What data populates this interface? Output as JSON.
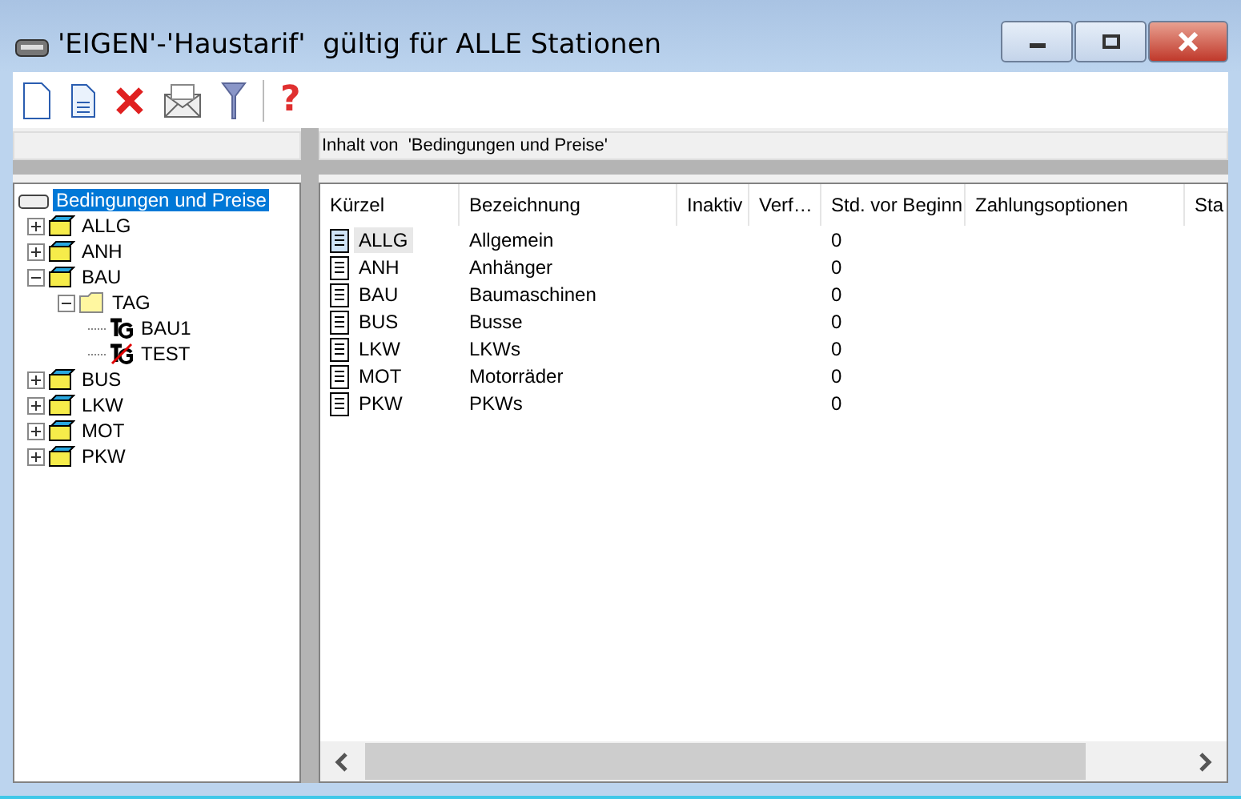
{
  "window": {
    "title": "'EIGEN'-'Haustarif'  gültig für ALLE Stationen"
  },
  "toolbar": {
    "help": "?"
  },
  "content_header": "Inhalt von  'Bedingungen und Preise'",
  "tree": {
    "label": "Bedingungen und Preise",
    "selected": true,
    "children": [
      {
        "label": "ALLG",
        "kind": "group",
        "expanded": false,
        "selected": false
      },
      {
        "label": "ANH",
        "kind": "group",
        "expanded": false,
        "selected": false
      },
      {
        "label": "BAU",
        "kind": "group",
        "expanded": true,
        "selected": false,
        "children": [
          {
            "label": "TAG",
            "kind": "folder",
            "expanded": true,
            "selected": false,
            "children": [
              {
                "label": "BAU1",
                "kind": "tariff",
                "inactive": false,
                "selected": false
              },
              {
                "label": "TEST",
                "kind": "tariff",
                "inactive": true,
                "selected": false
              }
            ]
          }
        ]
      },
      {
        "label": "BUS",
        "kind": "group",
        "expanded": false,
        "selected": false
      },
      {
        "label": "LKW",
        "kind": "group",
        "expanded": false,
        "selected": false
      },
      {
        "label": "MOT",
        "kind": "group",
        "expanded": false,
        "selected": false
      },
      {
        "label": "PKW",
        "kind": "group",
        "expanded": false,
        "selected": false
      }
    ]
  },
  "table": {
    "columns": [
      "Kürzel",
      "Bezeichnung",
      "Inaktiv",
      "Verf…",
      "Std. vor Beginn",
      "Zahlungsoptionen",
      "Sta"
    ],
    "rows": [
      {
        "selected": true,
        "cells": [
          "ALLG",
          "Allgemein",
          "",
          "",
          "0",
          "",
          ""
        ]
      },
      {
        "selected": false,
        "cells": [
          "ANH",
          "Anhänger",
          "",
          "",
          "0",
          "",
          ""
        ]
      },
      {
        "selected": false,
        "cells": [
          "BAU",
          "Baumaschinen",
          "",
          "",
          "0",
          "",
          ""
        ]
      },
      {
        "selected": false,
        "cells": [
          "BUS",
          "Busse",
          "",
          "",
          "0",
          "",
          ""
        ]
      },
      {
        "selected": false,
        "cells": [
          "LKW",
          "LKWs",
          "",
          "",
          "0",
          "",
          ""
        ]
      },
      {
        "selected": false,
        "cells": [
          "MOT",
          "Motorräder",
          "",
          "",
          "0",
          "",
          ""
        ]
      },
      {
        "selected": false,
        "cells": [
          "PKW",
          "PKWs",
          "",
          "",
          "0",
          "",
          ""
        ]
      }
    ]
  }
}
